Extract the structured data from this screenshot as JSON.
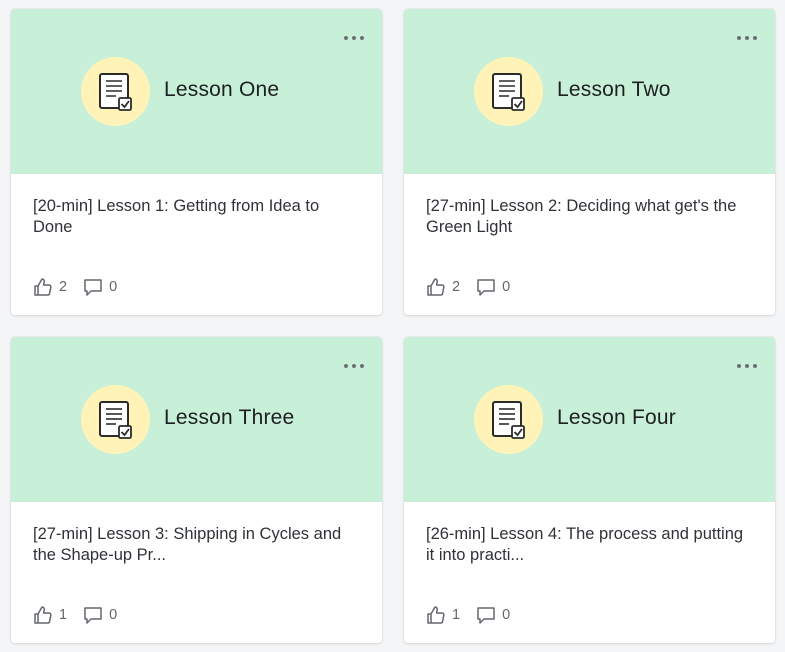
{
  "cards": [
    {
      "banner_label": "Lesson One",
      "title": "[20-min] Lesson 1: Getting from Idea to Done",
      "likes": "2",
      "comments": "0"
    },
    {
      "banner_label": "Lesson Two",
      "title": "[27-min] Lesson 2: Deciding what get's the Green Light",
      "likes": "2",
      "comments": "0"
    },
    {
      "banner_label": "Lesson Three",
      "title": "[27-min] Lesson 3: Shipping in Cycles and the Shape-up Pr...",
      "likes": "1",
      "comments": "0"
    },
    {
      "banner_label": "Lesson Four",
      "title": "[26-min] Lesson 4: The process and putting it into practi...",
      "likes": "1",
      "comments": "0"
    }
  ],
  "colors": {
    "banner_bg": "#c8f0d8",
    "badge_bg": "#fff3b8",
    "page_bg": "#f4f5f7"
  },
  "icons": {
    "menu": "more-horizontal-icon",
    "lesson": "document-check-icon",
    "like": "thumbs-up-icon",
    "comment": "comment-bubble-icon"
  }
}
